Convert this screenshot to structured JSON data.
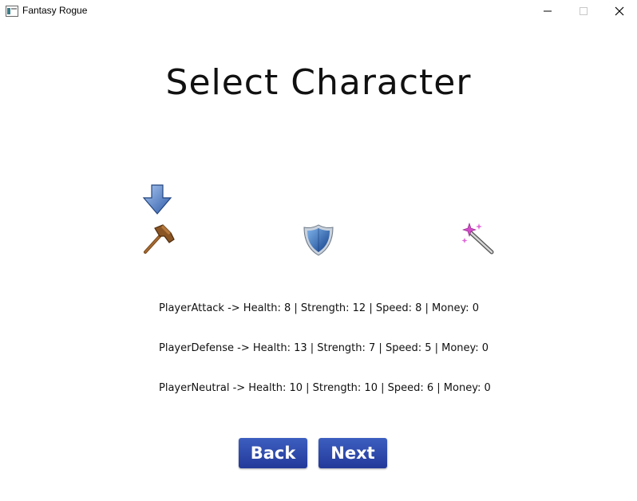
{
  "window": {
    "title": "Fantasy Rogue",
    "controls": {
      "minimize": "—",
      "maximize": "☐",
      "close": "✕"
    }
  },
  "screen": {
    "heading": "Select Character"
  },
  "characters": [
    {
      "icon": "hammer-icon",
      "selected": true
    },
    {
      "icon": "shield-icon",
      "selected": false
    },
    {
      "icon": "magic-wand-icon",
      "selected": false
    }
  ],
  "stats": [
    "PlayerAttack -> Health: 8 | Strength: 12 | Speed: 8 | Money: 0",
    "PlayerDefense -> Health: 13 | Strength: 7 | Speed: 5 | Money: 0",
    "PlayerNeutral -> Health: 10 | Strength: 10 | Speed: 6 | Money: 0"
  ],
  "buttons": {
    "back": "Back",
    "next": "Next"
  },
  "colors": {
    "button_top": "#3c5fc0",
    "button_bottom": "#23399a",
    "arrow": "#4f7fcf",
    "shield": "#1d5fb0",
    "wand_sparkle": "#d24bc8"
  }
}
